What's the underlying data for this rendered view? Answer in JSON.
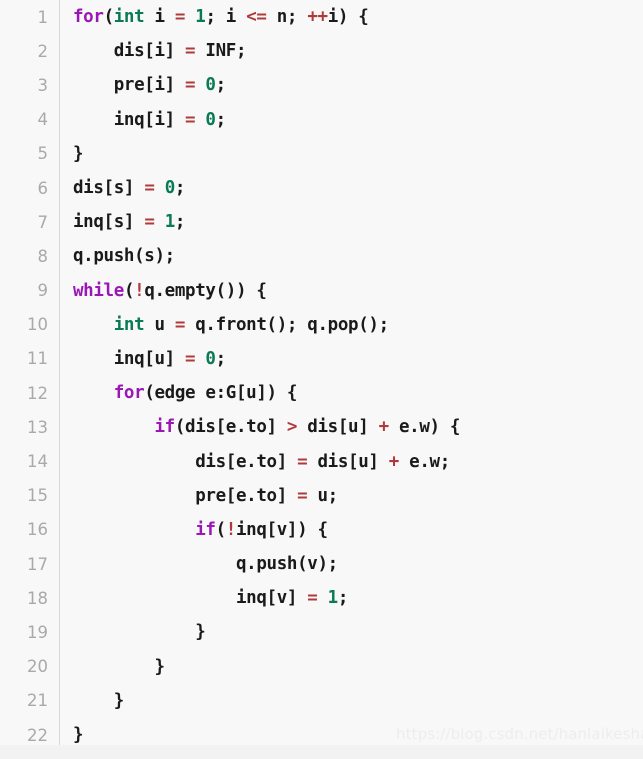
{
  "language": "cpp",
  "colors": {
    "background": "#f8f8f8",
    "gutter_text": "#a9a9a9",
    "gutter_divider": "#d8d8d8",
    "plain_text": "#1a1a1a",
    "keyword": "#9a16b5",
    "type": "#0a7a55",
    "number": "#0a7a55",
    "operator": "#b03a3a",
    "watermark": "#ededed"
  },
  "watermark": {
    "text": "https://blog.csdn.net/hanlaikeshao"
  },
  "code": {
    "line_count": 22,
    "line_numbers": [
      "1",
      "2",
      "3",
      "4",
      "5",
      "6",
      "7",
      "8",
      "9",
      "10",
      "11",
      "12",
      "13",
      "14",
      "15",
      "16",
      "17",
      "18",
      "19",
      "20",
      "21",
      "22"
    ],
    "plain_lines": [
      "for(int i = 1; i <= n; ++i) {",
      "    dis[i] = INF;",
      "    pre[i] = 0;",
      "    inq[i] = 0;",
      "}",
      "dis[s] = 0;",
      "inq[s] = 1;",
      "q.push(s);",
      "while(!q.empty()) {",
      "    int u = q.front(); q.pop();",
      "    inq[u] = 0;",
      "    for(edge e:G[u]) {",
      "        if(dis[e.to] > dis[u] + e.w) {",
      "            dis[e.to] = dis[u] + e.w;",
      "            pre[e.to] = u;",
      "            if(!inq[v]) {",
      "                q.push(v);",
      "                inq[v] = 1;",
      "            }",
      "        }",
      "    }",
      "}"
    ],
    "lines": [
      {
        "n": "1",
        "tokens": [
          {
            "t": "for",
            "c": "kw"
          },
          {
            "t": "(",
            "c": "pl"
          },
          {
            "t": "int",
            "c": "typ"
          },
          {
            "t": " i ",
            "c": "pl"
          },
          {
            "t": "=",
            "c": "op"
          },
          {
            "t": " ",
            "c": "pl"
          },
          {
            "t": "1",
            "c": "num"
          },
          {
            "t": "; i ",
            "c": "pl"
          },
          {
            "t": "<=",
            "c": "op"
          },
          {
            "t": " n; ",
            "c": "pl"
          },
          {
            "t": "++",
            "c": "op"
          },
          {
            "t": "i) {",
            "c": "pl"
          }
        ]
      },
      {
        "n": "2",
        "tokens": [
          {
            "t": "    dis[i] ",
            "c": "pl"
          },
          {
            "t": "=",
            "c": "op"
          },
          {
            "t": " INF;",
            "c": "pl"
          }
        ]
      },
      {
        "n": "3",
        "tokens": [
          {
            "t": "    pre[i] ",
            "c": "pl"
          },
          {
            "t": "=",
            "c": "op"
          },
          {
            "t": " ",
            "c": "pl"
          },
          {
            "t": "0",
            "c": "num"
          },
          {
            "t": ";",
            "c": "pl"
          }
        ]
      },
      {
        "n": "4",
        "tokens": [
          {
            "t": "    inq[i] ",
            "c": "pl"
          },
          {
            "t": "=",
            "c": "op"
          },
          {
            "t": " ",
            "c": "pl"
          },
          {
            "t": "0",
            "c": "num"
          },
          {
            "t": ";",
            "c": "pl"
          }
        ]
      },
      {
        "n": "5",
        "tokens": [
          {
            "t": "}",
            "c": "pl"
          }
        ]
      },
      {
        "n": "6",
        "tokens": [
          {
            "t": "dis[s] ",
            "c": "pl"
          },
          {
            "t": "=",
            "c": "op"
          },
          {
            "t": " ",
            "c": "pl"
          },
          {
            "t": "0",
            "c": "num"
          },
          {
            "t": ";",
            "c": "pl"
          }
        ]
      },
      {
        "n": "7",
        "tokens": [
          {
            "t": "inq[s] ",
            "c": "pl"
          },
          {
            "t": "=",
            "c": "op"
          },
          {
            "t": " ",
            "c": "pl"
          },
          {
            "t": "1",
            "c": "num"
          },
          {
            "t": ";",
            "c": "pl"
          }
        ]
      },
      {
        "n": "8",
        "tokens": [
          {
            "t": "q.push(s);",
            "c": "pl"
          }
        ]
      },
      {
        "n": "9",
        "tokens": [
          {
            "t": "while",
            "c": "kw"
          },
          {
            "t": "(",
            "c": "pl"
          },
          {
            "t": "!",
            "c": "op"
          },
          {
            "t": "q.empty()) {",
            "c": "pl"
          }
        ]
      },
      {
        "n": "10",
        "tokens": [
          {
            "t": "    ",
            "c": "pl"
          },
          {
            "t": "int",
            "c": "typ"
          },
          {
            "t": " u ",
            "c": "pl"
          },
          {
            "t": "=",
            "c": "op"
          },
          {
            "t": " q.front(); q.pop();",
            "c": "pl"
          }
        ]
      },
      {
        "n": "11",
        "tokens": [
          {
            "t": "    inq[u] ",
            "c": "pl"
          },
          {
            "t": "=",
            "c": "op"
          },
          {
            "t": " ",
            "c": "pl"
          },
          {
            "t": "0",
            "c": "num"
          },
          {
            "t": ";",
            "c": "pl"
          }
        ]
      },
      {
        "n": "12",
        "tokens": [
          {
            "t": "    ",
            "c": "pl"
          },
          {
            "t": "for",
            "c": "kw"
          },
          {
            "t": "(edge e:G[u]) {",
            "c": "pl"
          }
        ]
      },
      {
        "n": "13",
        "tokens": [
          {
            "t": "        ",
            "c": "pl"
          },
          {
            "t": "if",
            "c": "kw"
          },
          {
            "t": "(dis[e.to] ",
            "c": "pl"
          },
          {
            "t": ">",
            "c": "op"
          },
          {
            "t": " dis[u] ",
            "c": "pl"
          },
          {
            "t": "+",
            "c": "op"
          },
          {
            "t": " e.w) {",
            "c": "pl"
          }
        ]
      },
      {
        "n": "14",
        "tokens": [
          {
            "t": "            dis[e.to] ",
            "c": "pl"
          },
          {
            "t": "=",
            "c": "op"
          },
          {
            "t": " dis[u] ",
            "c": "pl"
          },
          {
            "t": "+",
            "c": "op"
          },
          {
            "t": " e.w;",
            "c": "pl"
          }
        ]
      },
      {
        "n": "15",
        "tokens": [
          {
            "t": "            pre[e.to] ",
            "c": "pl"
          },
          {
            "t": "=",
            "c": "op"
          },
          {
            "t": " u;",
            "c": "pl"
          }
        ]
      },
      {
        "n": "16",
        "tokens": [
          {
            "t": "            ",
            "c": "pl"
          },
          {
            "t": "if",
            "c": "kw"
          },
          {
            "t": "(",
            "c": "pl"
          },
          {
            "t": "!",
            "c": "op"
          },
          {
            "t": "inq[v]) {",
            "c": "pl"
          }
        ]
      },
      {
        "n": "17",
        "tokens": [
          {
            "t": "                q.push(v);",
            "c": "pl"
          }
        ]
      },
      {
        "n": "18",
        "tokens": [
          {
            "t": "                inq[v] ",
            "c": "pl"
          },
          {
            "t": "=",
            "c": "op"
          },
          {
            "t": " ",
            "c": "pl"
          },
          {
            "t": "1",
            "c": "num"
          },
          {
            "t": ";",
            "c": "pl"
          }
        ]
      },
      {
        "n": "19",
        "tokens": [
          {
            "t": "            }",
            "c": "pl"
          }
        ]
      },
      {
        "n": "20",
        "tokens": [
          {
            "t": "        }",
            "c": "pl"
          }
        ]
      },
      {
        "n": "21",
        "tokens": [
          {
            "t": "    }",
            "c": "pl"
          }
        ]
      },
      {
        "n": "22",
        "tokens": [
          {
            "t": "}",
            "c": "pl"
          }
        ]
      }
    ]
  }
}
